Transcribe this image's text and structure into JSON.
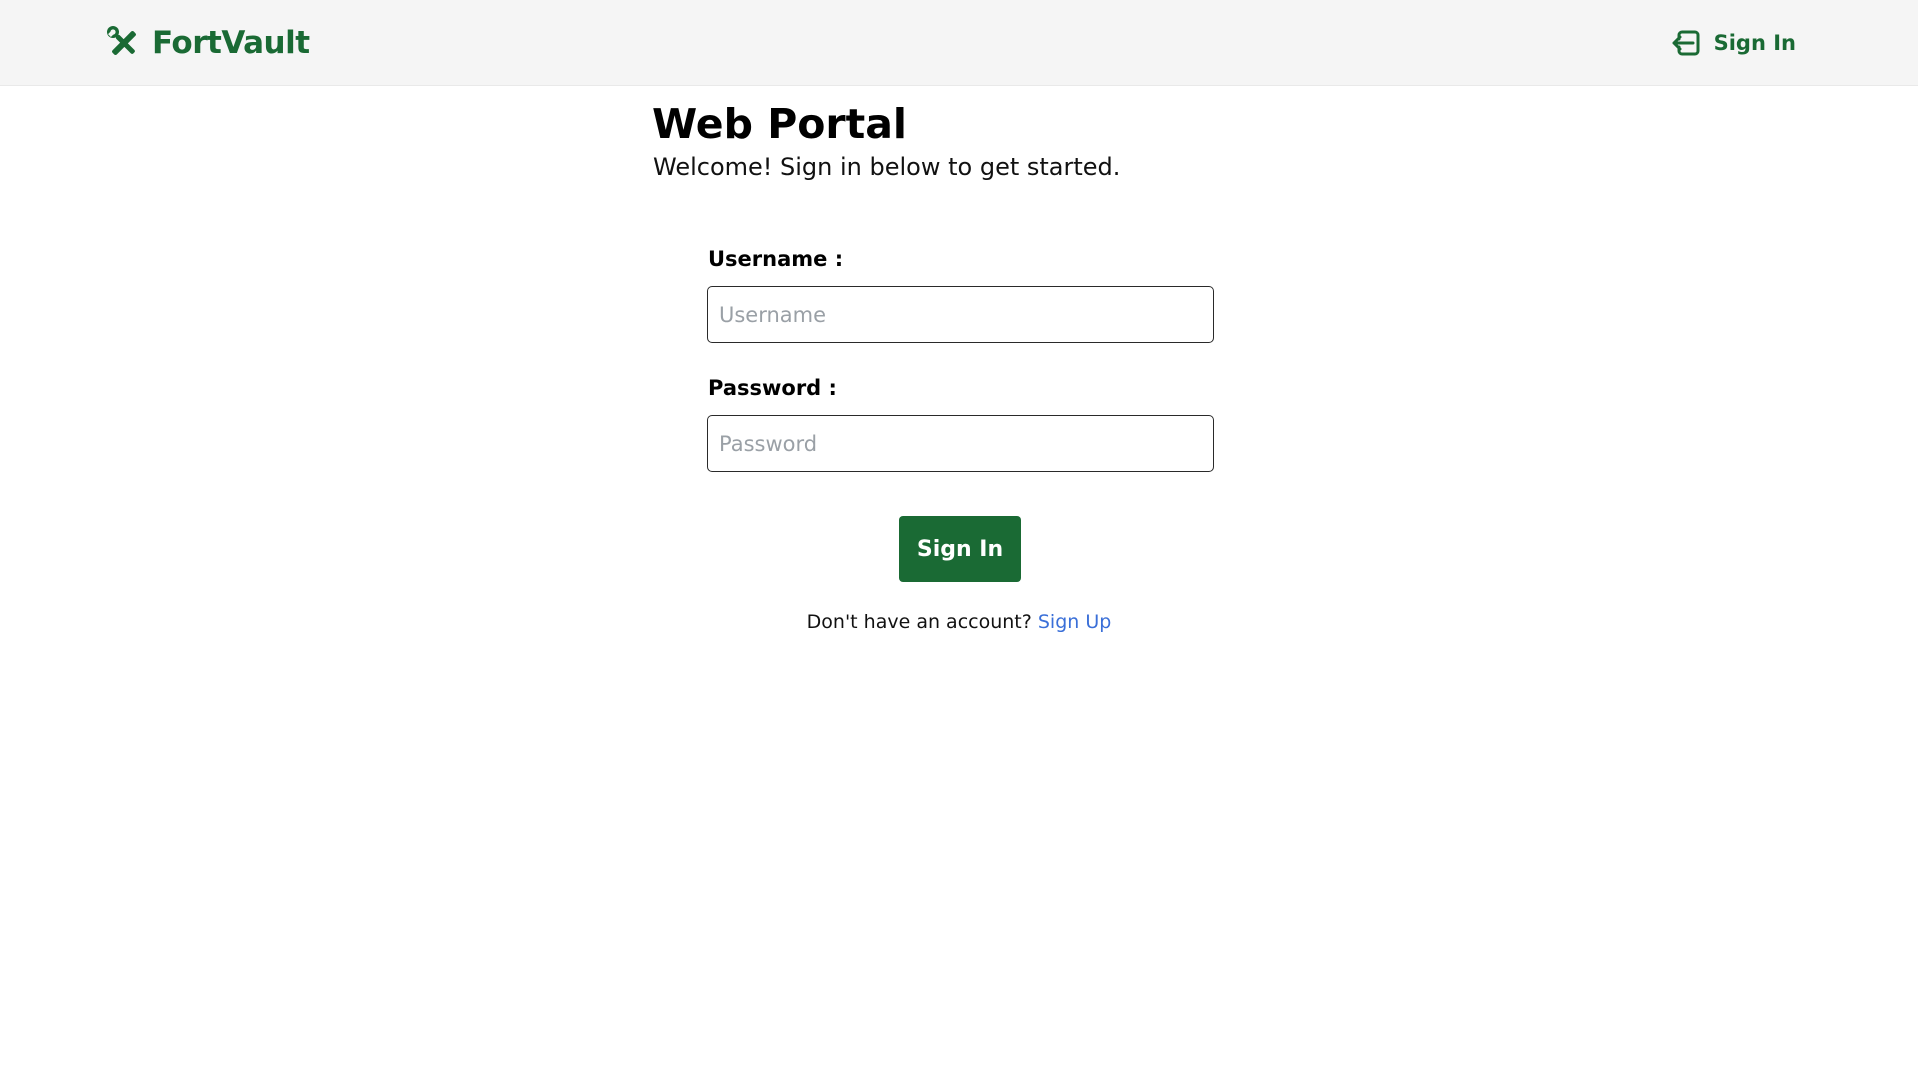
{
  "header": {
    "brand_name": "FortVault",
    "brand_icon": "tools-icon",
    "signin_label": "Sign In",
    "signin_icon": "sign-in-icon"
  },
  "main": {
    "title": "Web Portal",
    "subtitle": "Welcome! Sign in below to get started."
  },
  "form": {
    "username_label": "Username :",
    "username_placeholder": "Username",
    "username_value": "",
    "password_label": "Password :",
    "password_placeholder": "Password",
    "password_value": "",
    "submit_label": "Sign In"
  },
  "footer": {
    "signup_prompt": "Don't have an account?",
    "signup_link": "Sign Up"
  },
  "colors": {
    "brand_green": "#1a6a34",
    "header_bg": "#f5f5f5",
    "link_blue": "#3a6fd8"
  }
}
